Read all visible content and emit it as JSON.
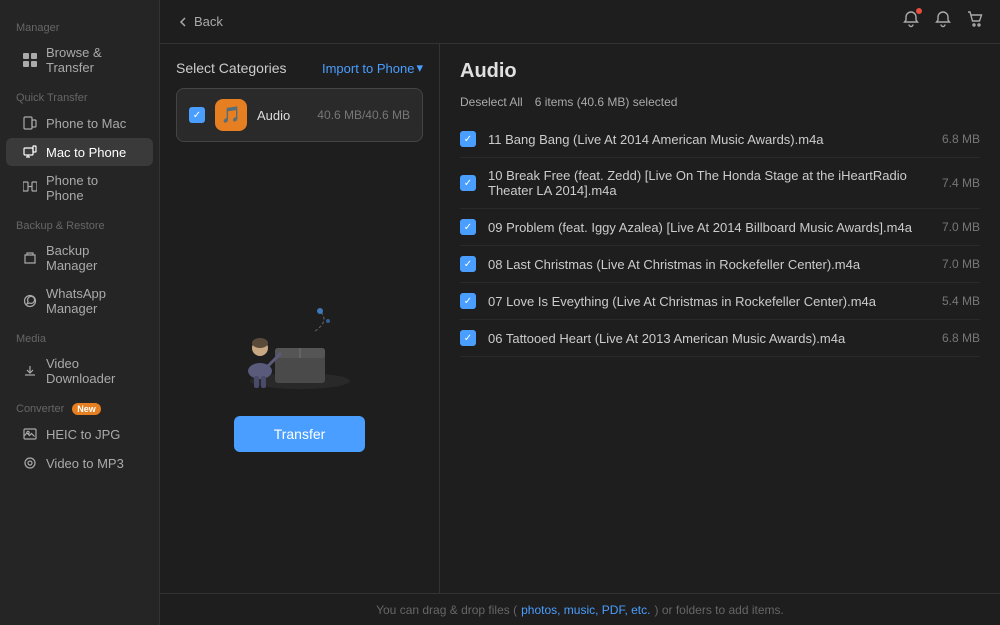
{
  "sidebar": {
    "sections": [
      {
        "label": "Manager",
        "items": [
          {
            "id": "browse-transfer",
            "label": "Browse & Transfer",
            "icon": "⊞",
            "active": false
          }
        ]
      },
      {
        "label": "Quick Transfer",
        "items": [
          {
            "id": "phone-to-mac",
            "label": "Phone to Mac",
            "icon": "📱",
            "active": false
          },
          {
            "id": "mac-to-phone",
            "label": "Mac to Phone",
            "icon": "💻",
            "active": true
          },
          {
            "id": "phone-to-phone",
            "label": "Phone to Phone",
            "icon": "📱",
            "active": false
          }
        ]
      },
      {
        "label": "Backup & Restore",
        "items": [
          {
            "id": "backup-manager",
            "label": "Backup Manager",
            "icon": "🗂",
            "active": false
          },
          {
            "id": "whatsapp-manager",
            "label": "WhatsApp Manager",
            "icon": "💬",
            "active": false
          }
        ]
      },
      {
        "label": "Media",
        "items": [
          {
            "id": "video-downloader",
            "label": "Video Downloader",
            "icon": "⬇",
            "active": false
          }
        ]
      },
      {
        "label": "Converter",
        "is_new": true,
        "items": [
          {
            "id": "heic-to-jpg",
            "label": "HEIC to JPG",
            "icon": "🖼",
            "active": false
          },
          {
            "id": "video-to-mp3",
            "label": "Video to MP3",
            "icon": "🎵",
            "active": false
          }
        ]
      }
    ]
  },
  "topbar": {
    "back_label": "Back"
  },
  "categories": {
    "title": "Select Categories",
    "import_btn": "Import to Phone",
    "items": [
      {
        "id": "audio",
        "name": "Audio",
        "size": "40.6 MB/40.6 MB",
        "checked": true
      }
    ]
  },
  "transfer_btn": "Transfer",
  "files_panel": {
    "title": "Audio",
    "deselect_label": "Deselect All",
    "selection_info": "6 items (40.6 MB) selected",
    "files": [
      {
        "name": "11 Bang Bang (Live At 2014 American Music Awards).m4a",
        "size": "6.8 MB"
      },
      {
        "name": "10 Break Free (feat. Zedd) [Live On The Honda Stage at the iHeartRadio Theater LA 2014].m4a",
        "size": "7.4 MB"
      },
      {
        "name": "09 Problem (feat. Iggy Azalea)  [Live At 2014 Billboard Music Awards].m4a",
        "size": "7.0 MB"
      },
      {
        "name": "08 Last Christmas  (Live At Christmas in Rockefeller Center).m4a",
        "size": "7.0 MB"
      },
      {
        "name": "07 Love Is Eveything (Live At Christmas in Rockefeller Center).m4a",
        "size": "5.4 MB"
      },
      {
        "name": "06 Tattooed Heart (Live At 2013 American Music Awards).m4a",
        "size": "6.8 MB"
      }
    ]
  },
  "bottom_bar": {
    "text": "You can drag & drop files (",
    "link_text": "photos, music, PDF, etc.",
    "text2": ") or folders to add items."
  },
  "colors": {
    "accent": "#4a9eff",
    "active_bg": "#3a3a3a",
    "orange": "#e67e22"
  }
}
